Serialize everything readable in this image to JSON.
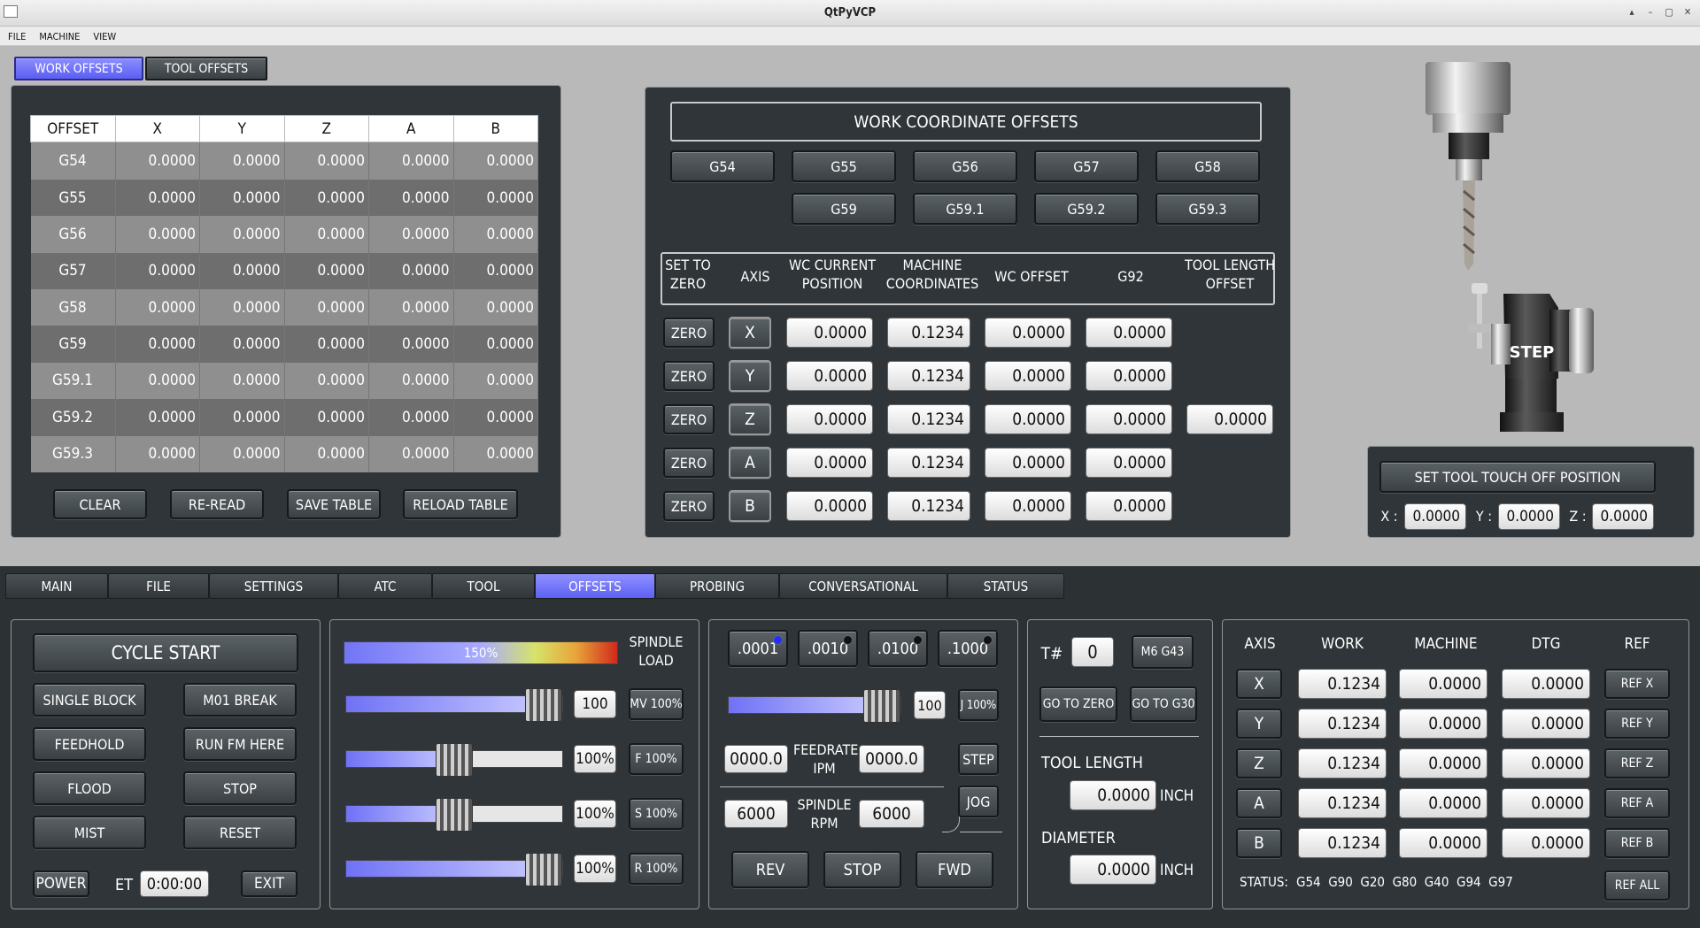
{
  "window": {
    "title": "QtPyVCP"
  },
  "menu": [
    "FILE",
    "MACHINE",
    "VIEW"
  ],
  "upper_tabs": [
    {
      "label": "WORK OFFSETS",
      "active": true
    },
    {
      "label": "TOOL OFFSETS",
      "active": false
    }
  ],
  "offset_table": {
    "headers": [
      "OFFSET",
      "X",
      "Y",
      "Z",
      "A",
      "B"
    ],
    "rows": [
      [
        "G54",
        "0.0000",
        "0.0000",
        "0.0000",
        "0.0000",
        "0.0000"
      ],
      [
        "G55",
        "0.0000",
        "0.0000",
        "0.0000",
        "0.0000",
        "0.0000"
      ],
      [
        "G56",
        "0.0000",
        "0.0000",
        "0.0000",
        "0.0000",
        "0.0000"
      ],
      [
        "G57",
        "0.0000",
        "0.0000",
        "0.0000",
        "0.0000",
        "0.0000"
      ],
      [
        "G58",
        "0.0000",
        "0.0000",
        "0.0000",
        "0.0000",
        "0.0000"
      ],
      [
        "G59",
        "0.0000",
        "0.0000",
        "0.0000",
        "0.0000",
        "0.0000"
      ],
      [
        "G59.1",
        "0.0000",
        "0.0000",
        "0.0000",
        "0.0000",
        "0.0000"
      ],
      [
        "G59.2",
        "0.0000",
        "0.0000",
        "0.0000",
        "0.0000",
        "0.0000"
      ],
      [
        "G59.3",
        "0.0000",
        "0.0000",
        "0.0000",
        "0.0000",
        "0.0000"
      ]
    ],
    "buttons": [
      "CLEAR",
      "RE-READ",
      "SAVE TABLE",
      "RELOAD TABLE"
    ]
  },
  "wco": {
    "title": "WORK COORDINATE OFFSETS",
    "coord_buttons": [
      "G54",
      "G55",
      "G56",
      "G57",
      "G58",
      "G59",
      "G59.1",
      "G59.2",
      "G59.3"
    ],
    "headers": [
      "SET TO\nZERO",
      "AXIS",
      "WC CURRENT\nPOSITION",
      "MACHINE\nCOORDINATES",
      "WC OFFSET",
      "G92",
      "TOOL LENGTH\nOFFSET"
    ],
    "zero_label": "ZERO",
    "rows": [
      {
        "axis": "X",
        "wc": "0.0000",
        "machine": "0.1234",
        "offset": "0.0000",
        "g92": "0.0000",
        "tlo": ""
      },
      {
        "axis": "Y",
        "wc": "0.0000",
        "machine": "0.1234",
        "offset": "0.0000",
        "g92": "0.0000",
        "tlo": ""
      },
      {
        "axis": "Z",
        "wc": "0.0000",
        "machine": "0.1234",
        "offset": "0.0000",
        "g92": "0.0000",
        "tlo": "0.0000"
      },
      {
        "axis": "A",
        "wc": "0.0000",
        "machine": "0.1234",
        "offset": "0.0000",
        "g92": "0.0000",
        "tlo": ""
      },
      {
        "axis": "B",
        "wc": "0.0000",
        "machine": "0.1234",
        "offset": "0.0000",
        "g92": "0.0000",
        "tlo": ""
      }
    ]
  },
  "touchoff": {
    "image_label": "STEP",
    "button": "SET TOOL TOUCH OFF POSITION",
    "x_label": "X :",
    "x": "0.0000",
    "y_label": "Y :",
    "y": "0.0000",
    "z_label": "Z :",
    "z": "0.0000"
  },
  "main_tabs": [
    {
      "label": "MAIN",
      "active": false
    },
    {
      "label": "FILE",
      "active": false
    },
    {
      "label": "SETTINGS",
      "active": false
    },
    {
      "label": "ATC",
      "active": false
    },
    {
      "label": "TOOL",
      "active": false
    },
    {
      "label": "OFFSETS",
      "active": true
    },
    {
      "label": "PROBING",
      "active": false
    },
    {
      "label": "CONVERSATIONAL",
      "active": false
    },
    {
      "label": "STATUS",
      "active": false
    }
  ],
  "control": {
    "cycle_start": "CYCLE START",
    "single_block": "SINGLE BLOCK",
    "m01_break": "M01 BREAK",
    "feedhold": "FEEDHOLD",
    "run_fm_here": "RUN FM HERE",
    "flood": "FLOOD",
    "stop": "STOP",
    "mist": "MIST",
    "reset": "RESET",
    "power": "POWER",
    "et_label": "ET",
    "et_value": "0:00:00",
    "exit": "EXIT"
  },
  "overrides": {
    "spindle_load_text": "150%",
    "spindle_load_label": "SPINDLE\nLOAD",
    "rows": [
      {
        "value": "100",
        "button": "MV 100%",
        "level": 1.0
      },
      {
        "value": "100%",
        "button": "F 100%",
        "level": 0.5
      },
      {
        "value": "100%",
        "button": "S 100%",
        "level": 0.5
      },
      {
        "value": "100%",
        "button": "R 100%",
        "level": 1.0
      }
    ]
  },
  "jog": {
    "increments": [
      {
        "label": ".0001",
        "active": true
      },
      {
        "label": ".0010",
        "active": false
      },
      {
        "label": ".0100",
        "active": false
      },
      {
        "label": ".1000",
        "active": false
      }
    ],
    "jog_value": "100",
    "jog_button": "J 100%",
    "jog_level": 1.0,
    "feed_left": "0000.0",
    "feed_label": "FEEDRATE\nIPM",
    "feed_right": "0000.0",
    "step": "STEP",
    "spindle_left": "6000",
    "spindle_label": "SPINDLE\nRPM",
    "spindle_right": "6000",
    "jog_mode": "JOG",
    "rev": "REV",
    "stop": "STOP",
    "fwd": "FWD"
  },
  "tool": {
    "t_label": "T#",
    "t_value": "0",
    "m6": "M6 G43",
    "go_zero": "GO TO ZERO",
    "go_g30": "GO TO G30",
    "length_label": "TOOL LENGTH",
    "length_value": "0.0000",
    "length_unit": "INCH",
    "diameter_label": "DIAMETER",
    "diameter_value": "0.0000",
    "diameter_unit": "INCH"
  },
  "dro": {
    "headers": [
      "AXIS",
      "WORK",
      "MACHINE",
      "DTG",
      "REF"
    ],
    "rows": [
      {
        "axis": "X",
        "work": "0.1234",
        "machine": "0.0000",
        "dtg": "0.0000",
        "ref": "REF X"
      },
      {
        "axis": "Y",
        "work": "0.1234",
        "machine": "0.0000",
        "dtg": "0.0000",
        "ref": "REF Y"
      },
      {
        "axis": "Z",
        "work": "0.1234",
        "machine": "0.0000",
        "dtg": "0.0000",
        "ref": "REF Z"
      },
      {
        "axis": "A",
        "work": "0.1234",
        "machine": "0.0000",
        "dtg": "0.0000",
        "ref": "REF A"
      },
      {
        "axis": "B",
        "work": "0.1234",
        "machine": "0.0000",
        "dtg": "0.0000",
        "ref": "REF B"
      }
    ],
    "status_label": "STATUS:",
    "status_value": "G54  G90  G20  G80  G40  G94  G97",
    "ref_all": "REF ALL"
  }
}
